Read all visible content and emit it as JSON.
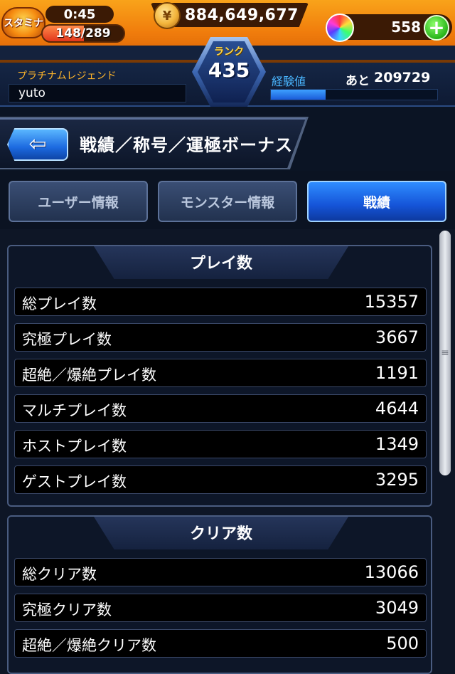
{
  "status": {
    "stamina_label": "スタミナ",
    "stamina_timer": "0:45",
    "stamina_current": "148/289",
    "stamina_fraction": 0.512,
    "coins": "884,649,677",
    "orbs": "558"
  },
  "player": {
    "title": "プラチナムレジェンド",
    "name": "yuto",
    "rank_label": "ランク",
    "rank": "435",
    "exp_label": "経験値",
    "exp_remaining_label": "あと",
    "exp_remaining": "209729",
    "exp_fraction": 0.33
  },
  "page": {
    "title": "戦績／称号／運極ボーナス"
  },
  "tabs": [
    {
      "label": "ユーザー情報",
      "active": false
    },
    {
      "label": "モンスター情報",
      "active": false
    },
    {
      "label": "戦績",
      "active": true
    }
  ],
  "sections": [
    {
      "title": "プレイ数",
      "rows": [
        {
          "label": "総プレイ数",
          "value": "15357"
        },
        {
          "label": "究極プレイ数",
          "value": "3667"
        },
        {
          "label": "超絶／爆絶プレイ数",
          "value": "1191"
        },
        {
          "label": "マルチプレイ数",
          "value": "4644"
        },
        {
          "label": "ホストプレイ数",
          "value": "1349"
        },
        {
          "label": "ゲストプレイ数",
          "value": "3295"
        }
      ]
    },
    {
      "title": "クリア数",
      "rows": [
        {
          "label": "総クリア数",
          "value": "13066"
        },
        {
          "label": "究極クリア数",
          "value": "3049"
        },
        {
          "label": "超絶／爆絶クリア数",
          "value": "500"
        }
      ]
    }
  ],
  "colors": {
    "accent_orange": "#f07c0c",
    "active_tab_blue": "#1554d8",
    "exp_blue": "#4ab6ff",
    "title_gold": "#ffb52a"
  }
}
